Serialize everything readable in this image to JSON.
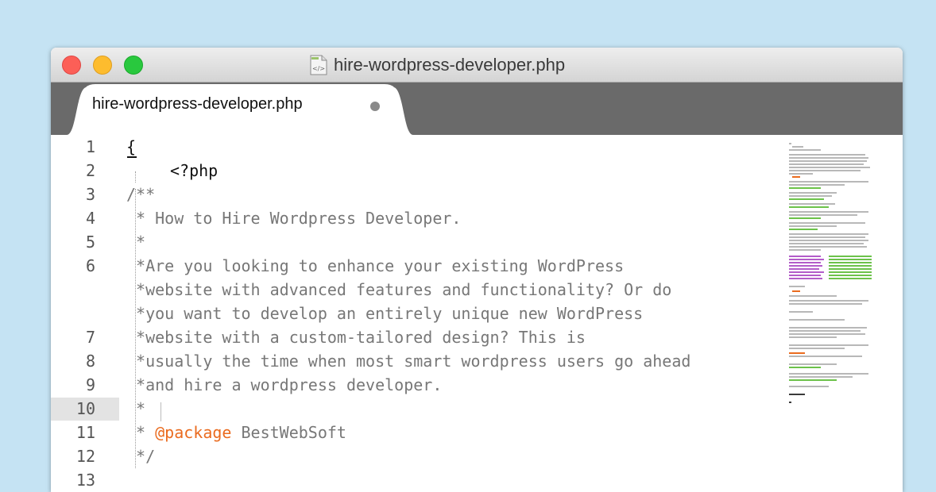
{
  "window": {
    "title": "hire-wordpress-developer.php",
    "controls": [
      "close",
      "minimize",
      "maximize"
    ],
    "title_icon": "php-file-icon"
  },
  "tab": {
    "label": "hire-wordpress-developer.php",
    "modified_indicator": "dirty-dot"
  },
  "editor": {
    "current_line": "10",
    "lines": [
      {
        "num": "1",
        "text": "{"
      },
      {
        "num": "2",
        "text": "<?php"
      },
      {
        "num": "3",
        "text": "/**"
      },
      {
        "num": "4",
        "text": " * How to Hire Wordpress Developer."
      },
      {
        "num": "5",
        "text": " *"
      },
      {
        "num": "6",
        "text": " *Are you looking to enhance your existing WordPress"
      },
      {
        "num": "",
        "text": " *website with advanced features and functionality? Or do"
      },
      {
        "num": "",
        "text": " *you want to develop an entirely unique new WordPress"
      },
      {
        "num": "7",
        "text": " *website with a custom-tailored design? This is"
      },
      {
        "num": "8",
        "text": " *usually the time when most smart wordpress users go ahead"
      },
      {
        "num": "9",
        "text": " *and hire a wordpress developer."
      },
      {
        "num": "10",
        "text": " *"
      },
      {
        "num": "11",
        "prefix": " * ",
        "tag": "@package",
        "rest": " BestWebSoft"
      },
      {
        "num": "12",
        "text": " */"
      },
      {
        "num": "13",
        "text": ""
      }
    ]
  },
  "colors": {
    "background": "#c5e3f3",
    "comment": "#777777",
    "annotation": "#ea6b1f",
    "tabbar": "#6a6a6a"
  }
}
